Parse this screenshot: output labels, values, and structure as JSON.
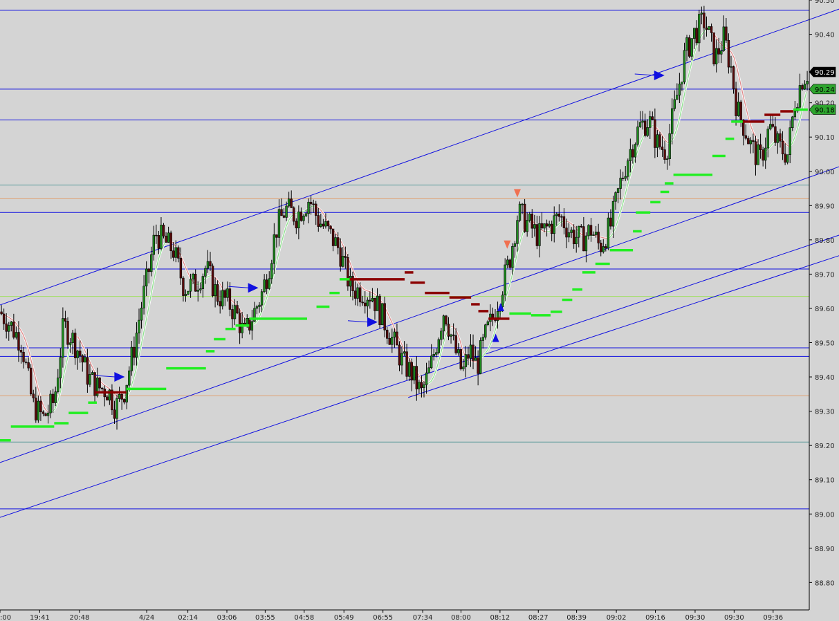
{
  "chart_data": {
    "type": "candlestick",
    "ylim": [
      88.72,
      90.5
    ],
    "x_count": 1120,
    "y_ticks": [
      {
        "label": "90.50",
        "v": 90.5
      },
      {
        "label": "90.40",
        "v": 90.4
      },
      {
        "label": "90.20",
        "v": 90.2
      },
      {
        "label": "90.10",
        "v": 90.1
      },
      {
        "label": "90.00",
        "v": 90.0
      },
      {
        "label": "89.90",
        "v": 89.9
      },
      {
        "label": "89.80",
        "v": 89.8
      },
      {
        "label": "89.70",
        "v": 89.7
      },
      {
        "label": "89.60",
        "v": 89.6
      },
      {
        "label": "89.50",
        "v": 89.5
      },
      {
        "label": "89.40",
        "v": 89.4
      },
      {
        "label": "89.30",
        "v": 89.3
      },
      {
        "label": "89.20",
        "v": 89.2
      },
      {
        "label": "89.10",
        "v": 89.1
      },
      {
        "label": "89.00",
        "v": 89.0
      },
      {
        "label": "88.90",
        "v": 88.9
      },
      {
        "label": "88.80",
        "v": 88.8
      }
    ],
    "x_ticks": [
      {
        "label": ":00",
        "x": 0
      },
      {
        "label": "19:41",
        "x": 55
      },
      {
        "label": "20:48",
        "x": 110
      },
      {
        "label": "4/24",
        "x": 203
      },
      {
        "label": "02:14",
        "x": 260
      },
      {
        "label": "03:06",
        "x": 314
      },
      {
        "label": "03:55",
        "x": 367
      },
      {
        "label": "04:58",
        "x": 421
      },
      {
        "label": "05:49",
        "x": 476
      },
      {
        "label": "06:55",
        "x": 530
      },
      {
        "label": "07:34",
        "x": 585
      },
      {
        "label": "08:00",
        "x": 638
      },
      {
        "label": "08:12",
        "x": 692
      },
      {
        "label": "08:27",
        "x": 745
      },
      {
        "label": "08:39",
        "x": 798
      },
      {
        "label": "09:02",
        "x": 853
      },
      {
        "label": "09:16",
        "x": 907
      },
      {
        "label": "09:30",
        "x": 962
      },
      {
        "label": "09:30",
        "x": 1016
      },
      {
        "label": "09:36",
        "x": 1070
      }
    ],
    "price_badges": [
      {
        "label": "90.29",
        "v": 90.29,
        "bg": "#000000",
        "fg": "#ffffff"
      },
      {
        "label": "90.24",
        "v": 90.24,
        "bg": "#2ea52e",
        "fg": "#000000"
      },
      {
        "label": "90.18",
        "v": 90.18,
        "bg": "#2ea52e",
        "fg": "#000000"
      }
    ],
    "horizontal_levels": [
      {
        "v": 90.47,
        "color": "#1010e0"
      },
      {
        "v": 90.24,
        "color": "#1010e0"
      },
      {
        "v": 90.15,
        "color": "#1010e0"
      },
      {
        "v": 89.96,
        "color": "#5a9a9a"
      },
      {
        "v": 89.92,
        "color": "#e0a070"
      },
      {
        "v": 89.88,
        "color": "#1010e0"
      },
      {
        "v": 89.715,
        "color": "#1010e0"
      },
      {
        "v": 89.635,
        "color": "#a0e060"
      },
      {
        "v": 89.485,
        "color": "#1010e0"
      },
      {
        "v": 89.46,
        "color": "#1010e0"
      },
      {
        "v": 89.345,
        "color": "#e0a070"
      },
      {
        "v": 89.21,
        "color": "#5a9a9a"
      },
      {
        "v": 89.015,
        "color": "#1010e0"
      }
    ],
    "trend_lines": [
      {
        "x1": 0,
        "v1": 89.61,
        "x2": 1170,
        "v2": 90.48
      },
      {
        "x1": 0,
        "v1": 89.15,
        "x2": 1170,
        "v2": 90.02
      },
      {
        "x1": 0,
        "v1": 88.99,
        "x2": 1170,
        "v2": 89.82
      },
      {
        "x1": 565,
        "v1": 89.34,
        "x2": 1170,
        "v2": 89.76
      }
    ],
    "series_points": [
      [
        0,
        89.59
      ],
      [
        15,
        89.55
      ],
      [
        30,
        89.5
      ],
      [
        45,
        89.32
      ],
      [
        60,
        89.28
      ],
      [
        75,
        89.33
      ],
      [
        88,
        89.55
      ],
      [
        98,
        89.52
      ],
      [
        110,
        89.47
      ],
      [
        122,
        89.4
      ],
      [
        135,
        89.37
      ],
      [
        150,
        89.36
      ],
      [
        160,
        89.31
      ],
      [
        172,
        89.36
      ],
      [
        185,
        89.48
      ],
      [
        195,
        89.6
      ],
      [
        205,
        89.7
      ],
      [
        215,
        89.82
      ],
      [
        225,
        89.8
      ],
      [
        240,
        89.77
      ],
      [
        255,
        89.66
      ],
      [
        270,
        89.67
      ],
      [
        285,
        89.72
      ],
      [
        300,
        89.64
      ],
      [
        315,
        89.62
      ],
      [
        328,
        89.58
      ],
      [
        338,
        89.52
      ],
      [
        350,
        89.58
      ],
      [
        362,
        89.64
      ],
      [
        372,
        89.72
      ],
      [
        382,
        89.83
      ],
      [
        395,
        89.89
      ],
      [
        410,
        89.87
      ],
      [
        428,
        89.92
      ],
      [
        440,
        89.86
      ],
      [
        455,
        89.82
      ],
      [
        470,
        89.77
      ],
      [
        485,
        89.66
      ],
      [
        500,
        89.65
      ],
      [
        515,
        89.64
      ],
      [
        530,
        89.57
      ],
      [
        545,
        89.5
      ],
      [
        558,
        89.44
      ],
      [
        570,
        89.41
      ],
      [
        583,
        89.35
      ],
      [
        595,
        89.42
      ],
      [
        605,
        89.51
      ],
      [
        615,
        89.6
      ],
      [
        628,
        89.49
      ],
      [
        640,
        89.41
      ],
      [
        650,
        89.48
      ],
      [
        660,
        89.43
      ],
      [
        672,
        89.52
      ],
      [
        683,
        89.58
      ],
      [
        693,
        89.65
      ],
      [
        705,
        89.74
      ],
      [
        717,
        89.88
      ],
      [
        730,
        89.85
      ],
      [
        745,
        89.81
      ],
      [
        760,
        89.84
      ],
      [
        775,
        89.87
      ],
      [
        790,
        89.82
      ],
      [
        805,
        89.8
      ],
      [
        818,
        89.83
      ],
      [
        830,
        89.78
      ],
      [
        845,
        89.84
      ],
      [
        858,
        89.96
      ],
      [
        870,
        90.05
      ],
      [
        885,
        90.13
      ],
      [
        898,
        90.15
      ],
      [
        910,
        90.08
      ],
      [
        922,
        90.06
      ],
      [
        935,
        90.2
      ],
      [
        948,
        90.34
      ],
      [
        960,
        90.4
      ],
      [
        975,
        90.44
      ],
      [
        990,
        90.33
      ],
      [
        1002,
        90.39
      ],
      [
        1012,
        90.3
      ],
      [
        1020,
        90.18
      ],
      [
        1030,
        90.13
      ],
      [
        1040,
        90.07
      ],
      [
        1052,
        90.03
      ],
      [
        1065,
        90.13
      ],
      [
        1078,
        90.07
      ],
      [
        1090,
        90.05
      ],
      [
        1100,
        90.2
      ],
      [
        1110,
        90.27
      ],
      [
        1118,
        90.29
      ]
    ],
    "stair_levels": [
      [
        0,
        89.215,
        "g"
      ],
      [
        15,
        89.255,
        "g"
      ],
      [
        75,
        89.265,
        "g"
      ],
      [
        95,
        89.295,
        "g"
      ],
      [
        122,
        89.325,
        "g"
      ],
      [
        132,
        89.355,
        "r"
      ],
      [
        175,
        89.365,
        "g"
      ],
      [
        230,
        89.425,
        "g"
      ],
      [
        285,
        89.475,
        "g"
      ],
      [
        296,
        89.51,
        "g"
      ],
      [
        312,
        89.54,
        "g"
      ],
      [
        326,
        89.55,
        "g"
      ],
      [
        345,
        89.57,
        "g"
      ],
      [
        438,
        89.605,
        "g"
      ],
      [
        456,
        89.645,
        "g"
      ],
      [
        470,
        89.685,
        "g"
      ],
      [
        484,
        89.685,
        "r"
      ],
      [
        560,
        89.705,
        "r"
      ],
      [
        568,
        89.675,
        "r"
      ],
      [
        588,
        89.645,
        "r"
      ],
      [
        622,
        89.632,
        "r"
      ],
      [
        652,
        89.612,
        "r"
      ],
      [
        662,
        89.592,
        "r"
      ],
      [
        676,
        89.57,
        "r"
      ],
      [
        705,
        89.585,
        "g"
      ],
      [
        735,
        89.58,
        "g"
      ],
      [
        762,
        89.59,
        "g"
      ],
      [
        778,
        89.625,
        "g"
      ],
      [
        792,
        89.655,
        "g"
      ],
      [
        806,
        89.705,
        "g"
      ],
      [
        824,
        89.73,
        "g"
      ],
      [
        844,
        89.77,
        "g"
      ],
      [
        876,
        89.825,
        "g"
      ],
      [
        880,
        89.88,
        "g"
      ],
      [
        900,
        89.91,
        "g"
      ],
      [
        914,
        89.94,
        "g"
      ],
      [
        920,
        89.965,
        "g"
      ],
      [
        932,
        89.99,
        "g"
      ],
      [
        986,
        90.045,
        "g"
      ],
      [
        1004,
        90.095,
        "g"
      ],
      [
        1012,
        90.145,
        "g"
      ],
      [
        1028,
        90.145,
        "r"
      ],
      [
        1058,
        90.165,
        "r"
      ],
      [
        1080,
        90.175,
        "r"
      ],
      [
        1098,
        90.18,
        "g"
      ]
    ],
    "markers": [
      {
        "kind": "arrow-right",
        "x": 165,
        "v": 89.4,
        "color": "#1010e0"
      },
      {
        "kind": "arrow-right",
        "x": 350,
        "v": 89.66,
        "color": "#1010e0"
      },
      {
        "kind": "arrow-right",
        "x": 515,
        "v": 89.56,
        "color": "#1010e0"
      },
      {
        "kind": "arrow-right",
        "x": 912,
        "v": 90.28,
        "color": "#1010e0"
      },
      {
        "kind": "arrow-up",
        "x": 686,
        "v": 89.51,
        "color": "#1010e0"
      },
      {
        "kind": "arrow-up",
        "x": 693,
        "v": 89.6,
        "color": "#1010e0"
      },
      {
        "kind": "arrow-down",
        "x": 716,
        "v": 89.94,
        "color": "#f07050"
      },
      {
        "kind": "arrow-down",
        "x": 702,
        "v": 89.79,
        "color": "#f07050"
      }
    ]
  }
}
